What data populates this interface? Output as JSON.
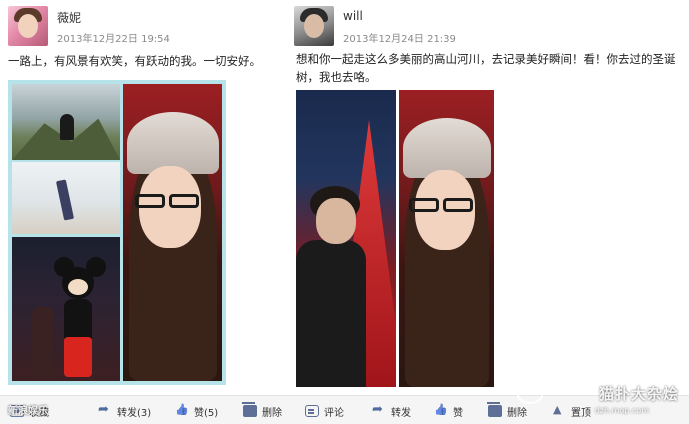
{
  "posts": [
    {
      "author": "薇妮",
      "timestamp": "2013年12月22日 19:54",
      "text": "一路上，有风景有欢笑，有跃动的我。一切安好。"
    },
    {
      "author": "will",
      "timestamp": "2013年12月24日 21:39",
      "text": "想和你一起走这么多美丽的高山河川，去记录美好瞬间！看！你去过的圣诞树，我也去咯。"
    }
  ],
  "actions": {
    "collect": "收藏",
    "share_left": "转发(3)",
    "like_left": "赞(5)",
    "delete_left": "删除",
    "comment": "评论",
    "share_right": "转发",
    "like_right": "赞",
    "delete_right": "删除",
    "top": "置顶"
  },
  "watermark": {
    "left": "新浪娱乐",
    "main": "猫扑大杂烩",
    "sub": "dzh.mop.com"
  },
  "colors": {
    "action_bar": "#f5f5f5",
    "collage_frame": "#b6e2ea",
    "icon": "#5d6f96"
  }
}
